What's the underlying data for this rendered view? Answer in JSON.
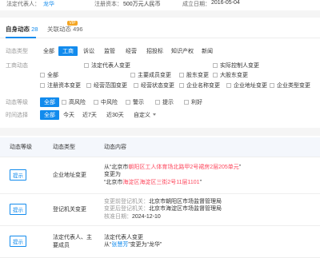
{
  "topbar": {
    "legal_rep_label": "法定代表人：",
    "legal_rep_value": "龙华",
    "capital_label": "注册资本：",
    "capital_value": "500万元人民币",
    "founded_label": "成立日期：",
    "founded_value": "2016-05-04"
  },
  "tabs": [
    {
      "label": "自身动态",
      "count": "28"
    },
    {
      "label": "关联动态",
      "count": "496"
    }
  ],
  "vip_badge": "VIP",
  "filters": {
    "type_label": "动态类型",
    "type_options": [
      "全部",
      "工商",
      "诉讼",
      "监管",
      "经营",
      "招投标",
      "知识产权",
      "新闻"
    ],
    "biz_label": "工商动态",
    "biz_options": [
      "全部",
      "法定代表人变更",
      "主要成员变更",
      "股东变更",
      "实际控制人变更",
      "大股东变更",
      "注册资本变更",
      "经营范围变更",
      "经营状态变更",
      "企业名称变更",
      "企业地址变更",
      "企业类型变更"
    ],
    "level_label": "动态等级",
    "level_options": [
      "全部",
      "高风险",
      "中风险",
      "警示",
      "提示",
      "利好"
    ],
    "time_label": "时间选择",
    "time_options": [
      "全部",
      "今天",
      "近7天",
      "近30天",
      "自定义"
    ]
  },
  "table": {
    "headers": [
      "动态等级",
      "动态类型",
      "动态内容"
    ],
    "rows": [
      {
        "level": "提示",
        "type": "企业地址变更",
        "lines": [
          {
            "pre": "从“北京市",
            "hl": "朝阳区工人体育场北路甲2号裙房2层205单元",
            "post": "”"
          },
          {
            "pre": "变更为",
            "hl": "",
            "post": ""
          },
          {
            "pre": "“北京市",
            "hl": "海淀区海淀区三街2号11层1101",
            "post": "”"
          }
        ]
      },
      {
        "level": "提示",
        "type": "登记机关变更",
        "lines": [
          {
            "label": "变更前登记机关：",
            "value": "北京市朝阳区市场监督管理局"
          },
          {
            "label": "变更后登记机关：",
            "value": "北京市海淀区市场监督管理局"
          },
          {
            "label": "核准日期：",
            "value": "2024-12-10"
          }
        ]
      },
      {
        "level": "提示",
        "type": "法定代表人、主要成员",
        "lines": [
          {
            "pre": "法定代表人变更",
            "hl": "",
            "post": ""
          },
          {
            "pre": "从“",
            "hl": "张慧芳",
            "post": "”变更为“龙华”"
          }
        ]
      }
    ]
  },
  "colors": {
    "accent": "#128bed",
    "highlight": "#fd485e",
    "vip": "#f5a623"
  }
}
